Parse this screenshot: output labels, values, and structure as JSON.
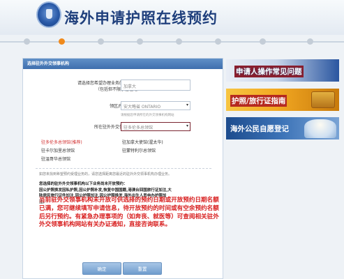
{
  "header": {
    "title": "海外申请护照在线预约"
  },
  "steps": {
    "total": 8,
    "active_index": 2
  },
  "panel": {
    "heading": "选择驻外外交领事机构",
    "country_label_line1": "请选择您希望办理业务的国家/地区",
    "country_label_line2": "（包括但不限于居住地）",
    "country_value": "加拿大",
    "district_label": "领区/所在地区：",
    "district_value": "安大略省 ONTARIO",
    "district_hint": "请根据您申请所在的外交领事机构网站",
    "post_label": "所在驻外外交领事机构：",
    "post_value": "驻多伦多总领馆",
    "posts": [
      {
        "label": "驻多伦多总领馆(推荐)",
        "highlight": true
      },
      {
        "label": "驻加拿大使馆(渥太华)",
        "highlight": false
      },
      {
        "label": "驻卡尔加里总领馆",
        "highlight": false
      },
      {
        "label": "驻蒙特利尔总领馆",
        "highlight": false
      },
      {
        "label": "驻温哥华总领馆",
        "highlight": false
      }
    ],
    "note": "如您未找到希望预约受理业务的，请您选择距离您最近的驻外外交领事机构办理业务。",
    "notice_lines": [
      "您选择的驻外外交领事机构以下业务尚未开放预约：",
      "因公护照换发因私护照,因公护照补发,恢复中国国籍,港澳台回国旅行证加注,大",
      "陆居民旅行证件加注,因公护照加注,因公护照换发,海外出生人员申办护照加",
      "注。"
    ],
    "warning": "当前驻外交领事机构未开放可供选择的预约日期或开放预约日期名额已满，您可继续填写申请信息，待开放预约的时间或有空余预约名额后另行预约。有紧急办理事项的（如奔丧、就医等）可查阅相关驻外外交领事机构网站有关办证通知，直接咨询联系。",
    "confirm_label": "确定",
    "reset_label": "重置"
  },
  "sidebar": {
    "banners": [
      {
        "label": "申请人操作常见问题"
      },
      {
        "label": "护照/旅行证指南"
      },
      {
        "label": "海外公民自愿登记"
      }
    ]
  },
  "colors": {
    "brand_blue": "#1f3f7c",
    "accent_orange": "#f08a1c",
    "warning_red": "#d81e1e"
  }
}
